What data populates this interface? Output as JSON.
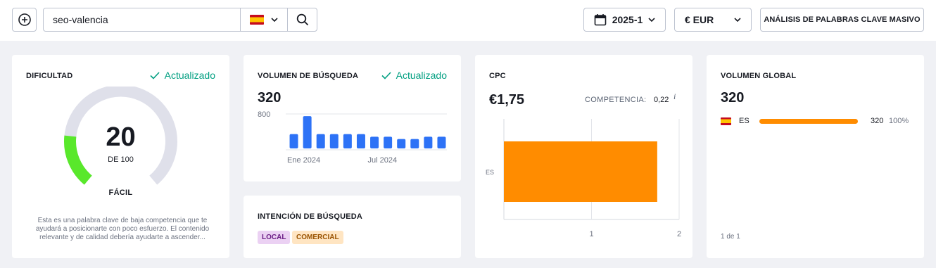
{
  "header": {
    "search_value": "seo-valencia",
    "database_flag": "spain-flag",
    "date_label": "2025-1",
    "currency_label": "€ EUR",
    "bulk_button_label": "ANÁLISIS DE PALABRAS CLAVE MASIVO"
  },
  "difficulty": {
    "title": "DIFICULTAD",
    "status": "Actualizado",
    "value": "20",
    "max_label": "DE 100",
    "level": "FÁCIL",
    "fraction": 0.2,
    "description": "Esta es una palabra clave de baja competencia que te ayudará a posicionarte con poco esfuerzo. El contenido relevante y de calidad debería ayudarte a ascender..."
  },
  "volume": {
    "title": "VOLUMEN DE BÚSQUEDA",
    "status": "Actualizado",
    "value": "320",
    "y_max_label": "800"
  },
  "chart_data": {
    "type": "bar",
    "x": [
      "Ene 2024",
      "Feb 2024",
      "Mar 2024",
      "Abr 2024",
      "May 2024",
      "Jun 2024",
      "Jul 2024",
      "Ago 2024",
      "Sep 2024",
      "Oct 2024",
      "Nov 2024",
      "Dic 2024"
    ],
    "x_tick_labels": [
      "Ene 2024",
      "Jul 2024"
    ],
    "values": [
      320,
      720,
      320,
      320,
      320,
      320,
      260,
      260,
      210,
      210,
      260,
      260
    ],
    "ylim": [
      0,
      800
    ],
    "grid": true
  },
  "intent": {
    "title": "INTENCIÓN DE BÚSQUEDA",
    "tags": [
      "LOCAL",
      "COMERCIAL"
    ]
  },
  "cpc": {
    "title": "CPC",
    "value": "€1,75",
    "competition_label": "COMPETENCIA:",
    "competition_value": "0,22",
    "info_icon": "info-icon",
    "bar_category": "ES",
    "bar_value": 1.75,
    "x_ticks": [
      "1",
      "2"
    ],
    "xlim": [
      0,
      2
    ]
  },
  "global": {
    "title": "VOLUMEN GLOBAL",
    "value": "320",
    "rows": [
      {
        "country": "ES",
        "volume": "320",
        "percent": "100%",
        "share": 1.0
      }
    ],
    "pagination": "1 de 1"
  },
  "colors": {
    "accent_blue": "#2d72f6",
    "orange": "#ff8c00",
    "green": "#59e82b",
    "updated_green": "#009f81"
  }
}
